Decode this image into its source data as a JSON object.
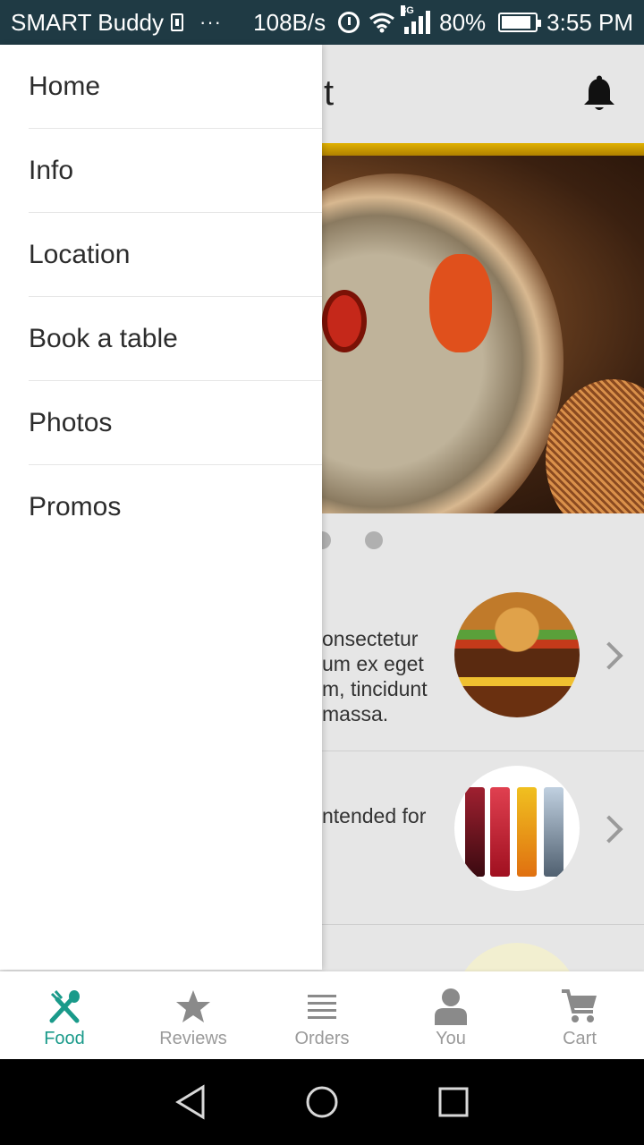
{
  "status_bar": {
    "carrier": "SMART Buddy",
    "more": "···",
    "net_speed": "108B/s",
    "network_type": "3G",
    "battery": "80%",
    "time": "3:55 PM"
  },
  "toolbar": {
    "title_fragment": "t"
  },
  "cards": [
    {
      "text_lines": [
        "onsectetur",
        "um ex eget",
        "m, tincidunt",
        "massa."
      ]
    },
    {
      "text_lines": [
        "ntended for"
      ]
    }
  ],
  "drawer": {
    "items": [
      "Home",
      "Info",
      "Location",
      "Book a table",
      "Photos",
      "Promos"
    ]
  },
  "bottom_nav": {
    "items": [
      {
        "label": "Food",
        "icon": "fork-spoon-icon",
        "active": true
      },
      {
        "label": "Reviews",
        "icon": "star-icon",
        "active": false
      },
      {
        "label": "Orders",
        "icon": "list-icon",
        "active": false
      },
      {
        "label": "You",
        "icon": "person-icon",
        "active": false
      },
      {
        "label": "Cart",
        "icon": "cart-icon",
        "active": false
      }
    ]
  },
  "colors": {
    "accent": "#1a9a8a",
    "status_bar": "#1f3a44",
    "toolbar_stripe": "#e0b100"
  }
}
